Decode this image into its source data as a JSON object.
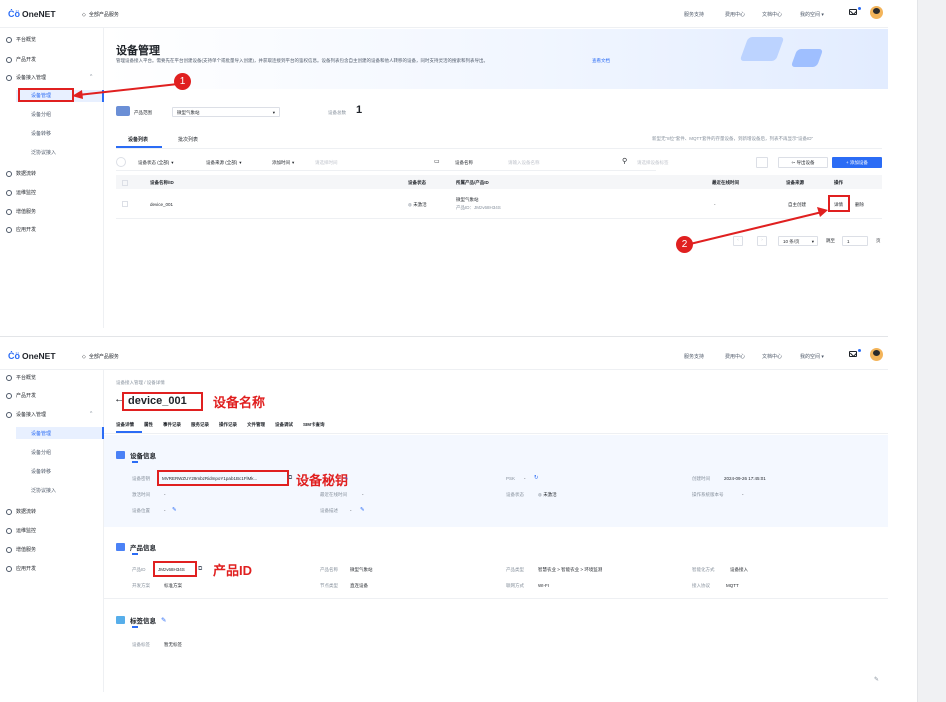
{
  "topbar": {
    "brand": "OneNET",
    "all_services": "全部产品服务",
    "nav": [
      "服务支持",
      "费用中心",
      "文档中心",
      "我的空间 ▾"
    ]
  },
  "sidebar": {
    "items": [
      {
        "label": "平台概览",
        "icon": "dashboard-icon"
      },
      {
        "label": "产品开发",
        "icon": "product-icon"
      },
      {
        "label": "设备接入管理",
        "icon": "device-icon"
      }
    ],
    "subitems": [
      "设备管理",
      "设备分组",
      "设备转移",
      "泛协议接入"
    ],
    "more": [
      {
        "label": "数据流转",
        "icon": "flow-icon"
      },
      {
        "label": "运维监控",
        "icon": "monitor-icon"
      },
      {
        "label": "增值服务",
        "icon": "share-icon"
      },
      {
        "label": "应用开发",
        "icon": "code-icon"
      }
    ]
  },
  "list_page": {
    "title": "设备管理",
    "description": "管理设备接入平台。需要先在平台创建设备(支持单个或批量导入创建)，并获取连接到平台的鉴权信息。设备列表包含自主创建的设备和他人转移的设备，同时支持灵活的搜索和列表导出。",
    "doc_link": "查看文档",
    "product_scope_label": "产品范围",
    "product_scope_value": "微型气象站",
    "device_total_label": "设备总数",
    "device_total_value": "1",
    "tabs": [
      "设备列表",
      "批次列表"
    ],
    "notice": "新型无\"8位\"套件、MQTT套件的存量设备，到新增设备后，列表不再显示\"设备ID\"",
    "filters": {
      "status": "设备状态 (全部)",
      "source": "设备来源 (全部)",
      "add_time": "添加时间",
      "time_placeholder": "请选择时间",
      "name_label": "设备名称",
      "name_placeholder": "请输入设备名称",
      "tag_placeholder": "请选择设备标签"
    },
    "export_label": "导出设备",
    "add_label": "+ 添加设备",
    "columns": [
      "设备名称/ID",
      "设备状态",
      "所属产品/产品ID",
      "最近在线时间",
      "设备来源",
      "操作"
    ],
    "rows": [
      {
        "name": "device_001",
        "status": "未激活",
        "product": "微型气象站",
        "product_id": "产品ID：JMzv68H34S",
        "last_online": "-",
        "source": "自主创建",
        "detail": "详情",
        "delete": "删除"
      }
    ],
    "pager": {
      "size": "10 条/页",
      "goto_label": "跳至",
      "goto_value": "1",
      "page_suffix": "页"
    }
  },
  "annotations": {
    "badge1": "1",
    "badge2": "2",
    "device_name": "设备名称",
    "device_secret": "设备秘钥",
    "product_id": "产品ID"
  },
  "detail_page": {
    "breadcrumb": [
      "设备接入管理",
      "设备详情"
    ],
    "device_name": "device_001",
    "tabs": [
      "设备详情",
      "属性",
      "事件记录",
      "服务记录",
      "操作记录",
      "文件管理",
      "设备调试",
      "SIM卡查询"
    ],
    "device_info": {
      "title": "设备信息",
      "key_label": "设备密钥",
      "key_value": "MVRERWZUY29mbzRidmpoY1pab1Bc1FlMk...",
      "psk_label": "PSK",
      "psk_value": "-",
      "created_label": "创建时间",
      "created_value": "2024-09-26 17:45:01",
      "activate_label": "激活时间",
      "activate_value": "-",
      "last_online_label": "最近在线时间",
      "last_online_value": "-",
      "status_label": "设备状态",
      "status_value": "未激活",
      "firmware_label": "操作系统版本号",
      "firmware_value": "-",
      "location_label": "设备位置",
      "location_value": "-",
      "desc_label": "设备描述",
      "desc_value": "-"
    },
    "product_info": {
      "title": "产品信息",
      "id_label": "产品ID",
      "id_value": "JMzv68H34S",
      "name_label": "产品名称",
      "name_value": "微型气象站",
      "type_label": "产品类型",
      "type_value": "智慧农业 > 智能农业 > 环境监测",
      "access_label": "智能化方式",
      "access_value": "设备接入",
      "dev_label": "开发方案",
      "dev_value": "标准方案",
      "node_label": "节点类型",
      "node_value": "直连设备",
      "net_label": "联网方式",
      "net_value": "WI-FI",
      "proto_label": "接入协议",
      "proto_value": "MQTT"
    },
    "tag_info": {
      "title": "标签信息",
      "tag_label": "设备标签",
      "tag_value": "暂无标签"
    }
  }
}
